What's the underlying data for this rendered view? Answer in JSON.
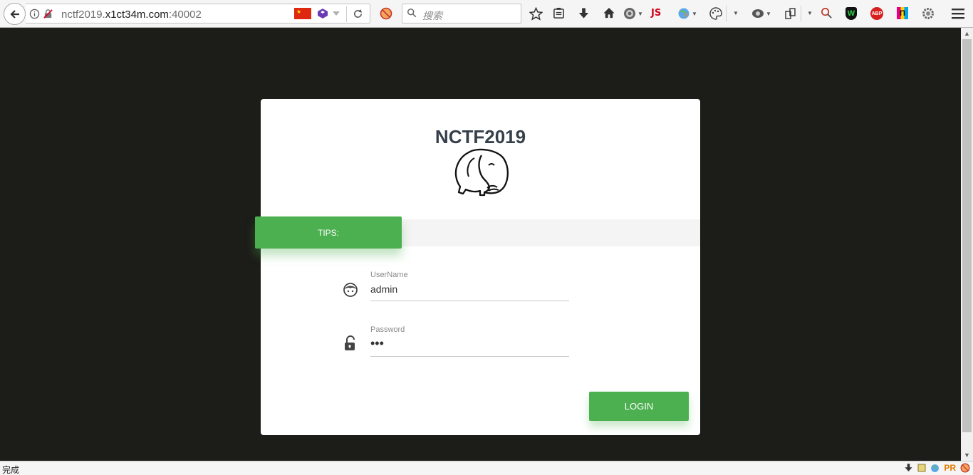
{
  "browser": {
    "url_prefix": "nctf2019.",
    "url_host": "x1ct34m.com",
    "url_port": ":40002",
    "search_placeholder": "搜索",
    "js_badge": "JS",
    "abp_label": "ABP",
    "pi_label": "Π",
    "shield_label": "W"
  },
  "card": {
    "title": "NCTF2019",
    "tips_label": "TIPS:",
    "username": {
      "label": "UserName",
      "value": "admin"
    },
    "password": {
      "label": "Password",
      "value": "•••"
    },
    "login_label": "LOGIN"
  },
  "status": {
    "text": "完成",
    "pr_label": "PR"
  },
  "colors": {
    "accent_green": "#4caf50",
    "page_background": "#1c1c18",
    "title_text": "#36404a"
  }
}
